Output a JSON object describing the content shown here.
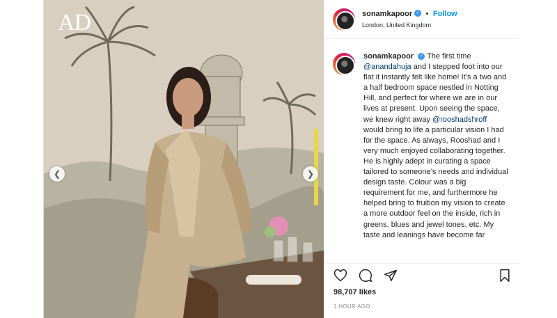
{
  "photo": {
    "watermark": "AD",
    "prev_icon": "chevron-left-icon",
    "next_icon": "chevron-right-icon"
  },
  "header": {
    "username": "sonamkapoor",
    "separator": "•",
    "follow_label": "Follow",
    "location": "London, United Kingdom",
    "more_label": "..."
  },
  "caption": {
    "username": "sonamkapoor",
    "intro": "The first time",
    "mention1": "@anandahuja",
    "part2": "and I stepped foot into our flat it instantly felt like home! It’s a two and a half bedroom space nestled in Notting Hill, and perfect for where we are in our lives at present. Upon seeing the space, we knew right away",
    "mention2": "@rooshadshroff",
    "part3": "would bring to life a particular vision I had for the space. As always, Rooshad and I very much enjoyed collaborating together. He is highly adept in curating a space tailored to someone’s needs and individual design taste. Colour was a big requirement for me, and furthermore he helped bring to fruition my vision to create a more outdoor feel on the inside, rich in greens, blues and jewel tones, etc. My taste and leanings have become far"
  },
  "stats": {
    "likes": "98,707 likes",
    "time": "1 HOUR AGO"
  },
  "colors": {
    "link_blue": "#0095f6",
    "mention_blue": "#00376b",
    "verified_blue": "#3897f0",
    "muted_gray": "#8e8e8e"
  }
}
